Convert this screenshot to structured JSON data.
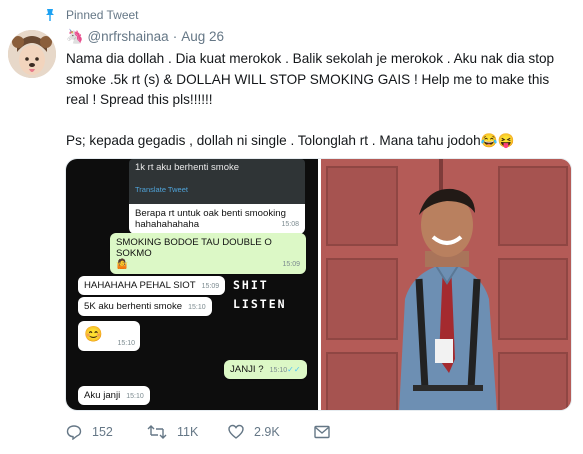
{
  "pinned_label": "Pinned Tweet",
  "author": {
    "handle": "@nrfrshainaa",
    "separator": "·",
    "date": "Aug 26",
    "crown_emoji": "🦄"
  },
  "tweet": {
    "paragraph1": "Nama dia dollah . Dia kuat merokok . Balik sekolah je merokok . Aku nak dia stop smoke .5k rt (s) & DOLLAH WILL STOP SMOKING GAIS ! Help me to make this real ! Spread this pls!!!!!!",
    "paragraph2": "Ps; kepada gegadis , dollah ni single . Tolonglah rt . Mana tahu jodoh😂😝"
  },
  "chat": {
    "quoted_text": "1k rt aku berhenti smoke",
    "translate_label": "Translate Tweet",
    "msg1_line1": "Berapa rt untuk oak benti smooking",
    "msg1_line2": "hahahahahaha",
    "msg1_time": "15:08",
    "msg2_text": "SMOKING BODOE TAU DOUBLE O SOKMO",
    "msg2_time": "15:09",
    "msg3_text": "HAHAHAHA PEHAL SIOT",
    "msg3_time": "15:09",
    "msg4_text": "5K aku berhenti smoke",
    "msg4_time": "15:10",
    "msg5_emoji": "😊",
    "msg5_time": "15:10",
    "msg6_text": "JANJI ?",
    "msg6_time": "15:10",
    "msg7_text": "Aku janji",
    "msg7_time": "15:10",
    "meme_line1": "SHIT",
    "meme_line2": "LISTEN"
  },
  "actions": {
    "replies": "152",
    "retweets": "11K",
    "likes": "2.9K"
  },
  "colors": {
    "muted": "#657786",
    "text": "#14171a",
    "bubble_out": "#dcf8c6",
    "door": "#b85e5a"
  },
  "icons": [
    "pin-icon",
    "reply-icon",
    "retweet-icon",
    "like-icon",
    "message-icon"
  ]
}
